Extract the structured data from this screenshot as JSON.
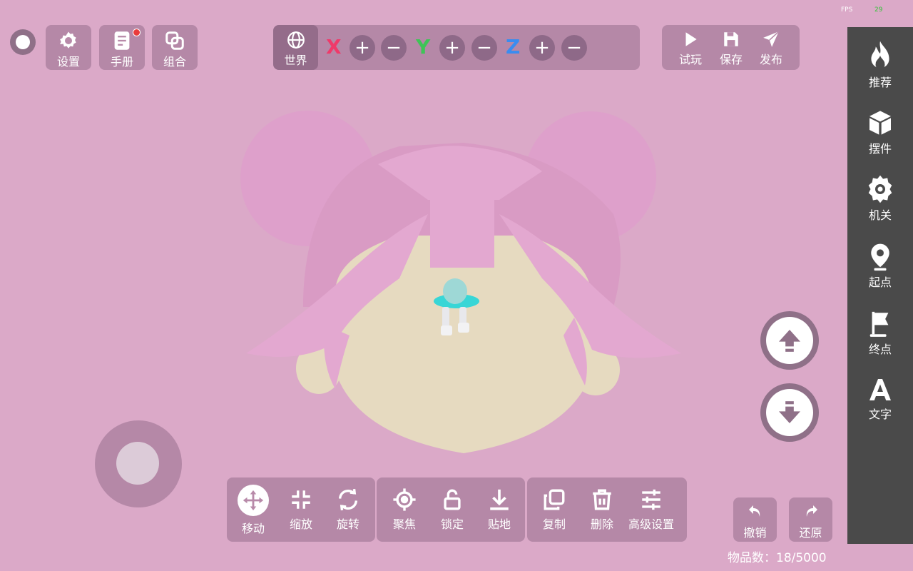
{
  "hud": {
    "fps_label": "FPS",
    "fps_value": "29"
  },
  "top_left": {
    "settings_label": "设置",
    "manual_label": "手册",
    "group_label": "组合"
  },
  "axis_bar": {
    "world_label": "世界",
    "x_label": "X",
    "y_label": "Y",
    "z_label": "Z",
    "plus": "+",
    "minus": "−",
    "colors": {
      "x": "#ef3a6a",
      "y": "#3fc457",
      "z": "#3a8cf0"
    }
  },
  "top_right": {
    "play_label": "试玩",
    "save_label": "保存",
    "publish_label": "发布"
  },
  "sidebar": {
    "items": [
      {
        "label": "推荐",
        "icon": "flame-icon"
      },
      {
        "label": "摆件",
        "icon": "cube-icon"
      },
      {
        "label": "机关",
        "icon": "gear-icon"
      },
      {
        "label": "起点",
        "icon": "location-pin-icon"
      },
      {
        "label": "终点",
        "icon": "flag-icon"
      },
      {
        "label": "文字",
        "icon": "letter-a-icon"
      }
    ]
  },
  "toolbar": {
    "move_label": "移动",
    "scale_label": "缩放",
    "rotate_label": "旋转",
    "focus_label": "聚焦",
    "lock_label": "锁定",
    "ground_label": "贴地",
    "copy_label": "复制",
    "delete_label": "删除",
    "advanced_label": "高级设置"
  },
  "history": {
    "undo_label": "撤销",
    "redo_label": "还原"
  },
  "status": {
    "item_count": "物品数：18/5000"
  }
}
